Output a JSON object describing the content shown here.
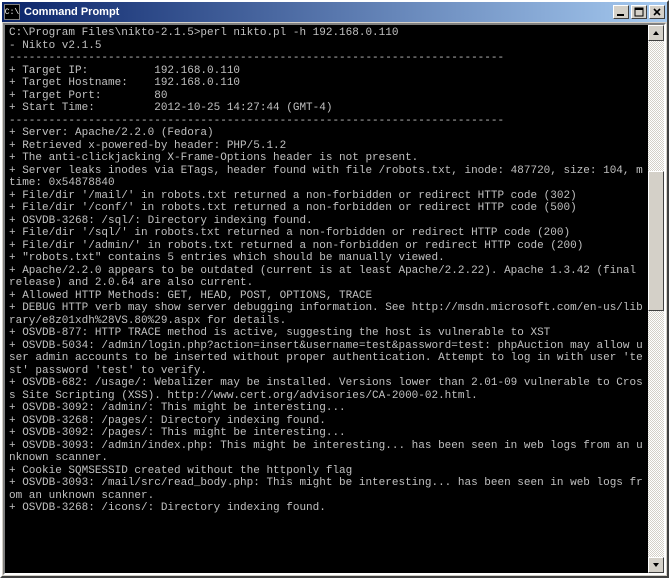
{
  "window": {
    "title": "Command Prompt",
    "icon_label": "C:\\"
  },
  "terminal": {
    "prompt": "C:\\Program Files\\nikto-2.1.5>",
    "command": "perl nikto.pl -h 192.168.0.110",
    "lines": [
      "- Nikto v2.1.5",
      "---------------------------------------------------------------------------",
      "+ Target IP:          192.168.0.110",
      "+ Target Hostname:    192.168.0.110",
      "+ Target Port:        80",
      "+ Start Time:         2012-10-25 14:27:44 (GMT-4)",
      "---------------------------------------------------------------------------",
      "+ Server: Apache/2.2.0 (Fedora)",
      "+ Retrieved x-powered-by header: PHP/5.1.2",
      "+ The anti-clickjacking X-Frame-Options header is not present.",
      "+ Server leaks inodes via ETags, header found with file /robots.txt, inode: 487720, size: 104, mtime: 0x54878840",
      "+ File/dir '/mail/' in robots.txt returned a non-forbidden or redirect HTTP code (302)",
      "+ File/dir '/conf/' in robots.txt returned a non-forbidden or redirect HTTP code (500)",
      "+ OSVDB-3268: /sql/: Directory indexing found.",
      "+ File/dir '/sql/' in robots.txt returned a non-forbidden or redirect HTTP code (200)",
      "+ File/dir '/admin/' in robots.txt returned a non-forbidden or redirect HTTP code (200)",
      "+ \"robots.txt\" contains 5 entries which should be manually viewed.",
      "+ Apache/2.2.0 appears to be outdated (current is at least Apache/2.2.22). Apache 1.3.42 (final release) and 2.0.64 are also current.",
      "+ Allowed HTTP Methods: GET, HEAD, POST, OPTIONS, TRACE ",
      "+ DEBUG HTTP verb may show server debugging information. See http://msdn.microsoft.com/en-us/library/e8z01xdh%28VS.80%29.aspx for details.",
      "+ OSVDB-877: HTTP TRACE method is active, suggesting the host is vulnerable to XST",
      "+ OSVDB-5034: /admin/login.php?action=insert&username=test&password=test: phpAuction may allow user admin accounts to be inserted without proper authentication. Attempt to log in with user 'test' password 'test' to verify.",
      "+ OSVDB-682: /usage/: Webalizer may be installed. Versions lower than 2.01-09 vulnerable to Cross Site Scripting (XSS). http://www.cert.org/advisories/CA-2000-02.html.",
      "+ OSVDB-3092: /admin/: This might be interesting...",
      "+ OSVDB-3268: /pages/: Directory indexing found.",
      "+ OSVDB-3092: /pages/: This might be interesting...",
      "+ OSVDB-3093: /admin/index.php: This might be interesting... has been seen in web logs from an unknown scanner.",
      "+ Cookie SQMSESSID created without the httponly flag",
      "+ OSVDB-3093: /mail/src/read_body.php: This might be interesting... has been seen in web logs from an unknown scanner.",
      "+ OSVDB-3268: /icons/: Directory indexing found."
    ]
  }
}
